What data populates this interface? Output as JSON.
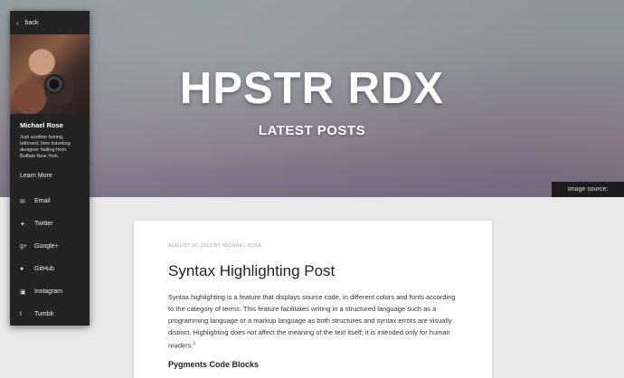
{
  "hero": {
    "title": "HPSTR RDX",
    "subtitle": "LATEST POSTS",
    "image_credit": "Image source: dargadgetz"
  },
  "sidebar": {
    "back_label": "back",
    "name": "Michael Rose",
    "bio": "Just another boring, tattooed, time traveling designer hailing from Buffalo New York.",
    "learn_more": "Learn More",
    "links": [
      {
        "label": "Email",
        "icon": "envelope-icon"
      },
      {
        "label": "Twitter",
        "icon": "twitter-icon"
      },
      {
        "label": "Google+",
        "icon": "google-plus-icon"
      },
      {
        "label": "GitHub",
        "icon": "github-icon"
      },
      {
        "label": "Instagram",
        "icon": "instagram-icon"
      },
      {
        "label": "Tumblr",
        "icon": "tumblr-icon"
      }
    ]
  },
  "post": {
    "meta": "AUGUST 16, 2013 BY MICHAEL ROSE",
    "title": "Syntax Highlighting Post",
    "excerpt": "Syntax highlighting is a feature that displays source code, in different colors and fonts according to the category of terms. This feature facilitates writing in a structured language such as a programming language or a markup language as both structures and syntax errors are visually distinct. Highlighting does not affect the meaning of the text itself; it is intended only for human readers.",
    "footnote": "1",
    "subheading": "Pygments Code Blocks"
  }
}
